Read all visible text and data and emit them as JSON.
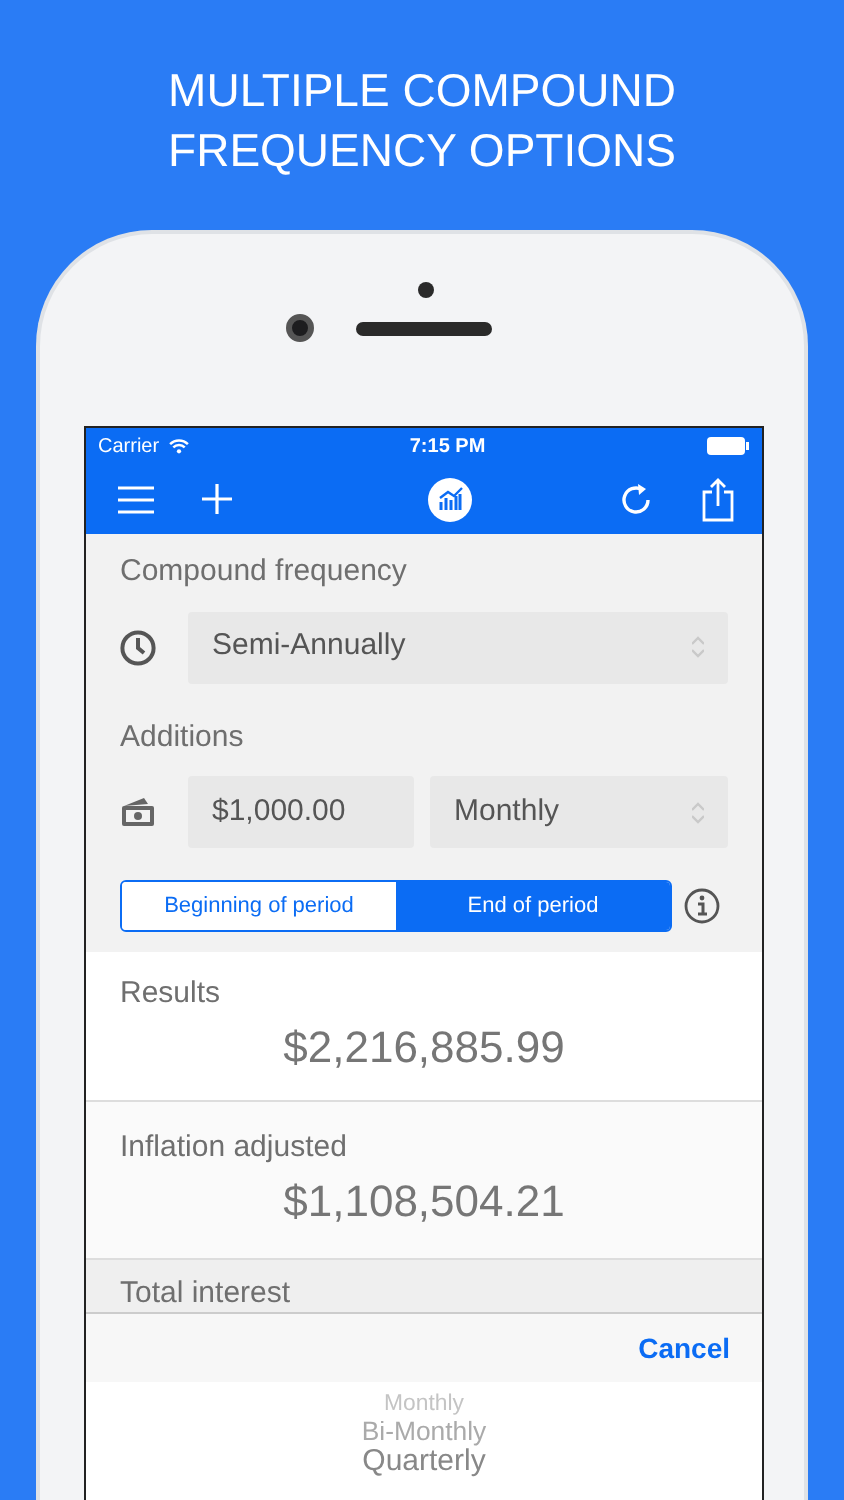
{
  "headline": "MULTIPLE COMPOUND FREQUENCY OPTIONS",
  "status_bar": {
    "carrier": "Carrier",
    "time": "7:15 PM"
  },
  "compound_frequency": {
    "label": "Compound frequency",
    "value": "Semi-Annually"
  },
  "additions": {
    "label": "Additions",
    "amount": "$1,000.00",
    "frequency": "Monthly"
  },
  "timing": [
    {
      "label": "Beginning of period",
      "selected": false
    },
    {
      "label": "End of period",
      "selected": true
    }
  ],
  "results": [
    {
      "label": "Results",
      "value": "$2,216,885.99"
    },
    {
      "label": "Inflation adjusted",
      "value": "$1,108,504.21"
    },
    {
      "label": "Total interest"
    }
  ],
  "picker": {
    "cancel": "Cancel",
    "options": [
      "Monthly",
      "Bi-Monthly",
      "Quarterly"
    ]
  }
}
